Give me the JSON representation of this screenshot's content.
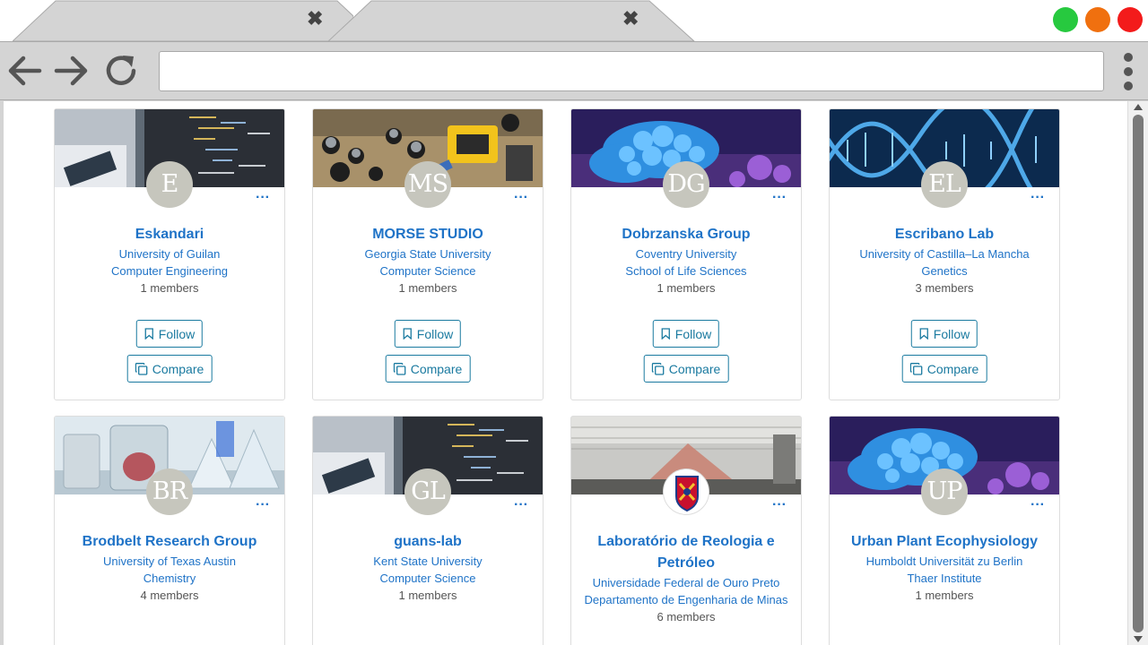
{
  "browser": {
    "tabs": [
      {
        "close_glyph": "✖"
      },
      {
        "close_glyph": "✖"
      }
    ],
    "address_value": "",
    "window_controls": [
      {
        "name": "maximize",
        "color": "#27c93f"
      },
      {
        "name": "minimize",
        "color": "#f0700f"
      },
      {
        "name": "close",
        "color": "#f31b1b"
      }
    ]
  },
  "colors": {
    "link": "#1f73c7",
    "button": "#1a7aa0",
    "avatar_bg": "#c6c6bd"
  },
  "cards": [
    {
      "initials": "E",
      "title": "Eskandari",
      "institution": "University of Guilan",
      "department": "Computer Engineering",
      "members": "1 members",
      "follow_label": "Follow",
      "compare_label": "Compare",
      "menu": "···",
      "banner": "code"
    },
    {
      "initials": "MS",
      "title": "MORSE STUDIO",
      "institution": "Georgia State University",
      "department": "Computer Science",
      "members": "1 members",
      "follow_label": "Follow",
      "compare_label": "Compare",
      "menu": "···",
      "banner": "circuit"
    },
    {
      "initials": "DG",
      "title": "Dobrzanska Group",
      "institution": "Coventry University",
      "department": "School of Life Sciences",
      "members": "1 members",
      "follow_label": "Follow",
      "compare_label": "Compare",
      "menu": "···",
      "banner": "coral"
    },
    {
      "initials": "EL",
      "title": "Escribano Lab",
      "institution": "University of Castilla–La Mancha",
      "department": "Genetics",
      "members": "3 members",
      "follow_label": "Follow",
      "compare_label": "Compare",
      "menu": "···",
      "banner": "dna"
    },
    {
      "initials": "BR",
      "title": "Brodbelt Research Group",
      "institution": "University of Texas Austin",
      "department": "Chemistry",
      "members": "4 members",
      "menu": "···",
      "banner": "glassware"
    },
    {
      "initials": "GL",
      "title": "guans-lab",
      "institution": "Kent State University",
      "department": "Computer Science",
      "members": "1 members",
      "menu": "···",
      "banner": "code"
    },
    {
      "initials": "",
      "title_line1": "Laboratório de Reologia e",
      "title_line2": "Petróleo",
      "institution": "Universidade Federal de Ouro Preto",
      "department": "Departamento de Engenharia de Minas",
      "members": "6 members",
      "menu": "···",
      "banner": "rheology",
      "logo_text": "ESCOLA DE MINAS"
    },
    {
      "initials": "UP",
      "title": "Urban Plant Ecophysiology",
      "institution": "Humboldt Universität zu Berlin",
      "department": "Thaer Institute",
      "members": "1 members",
      "menu": "···",
      "banner": "coral"
    }
  ]
}
